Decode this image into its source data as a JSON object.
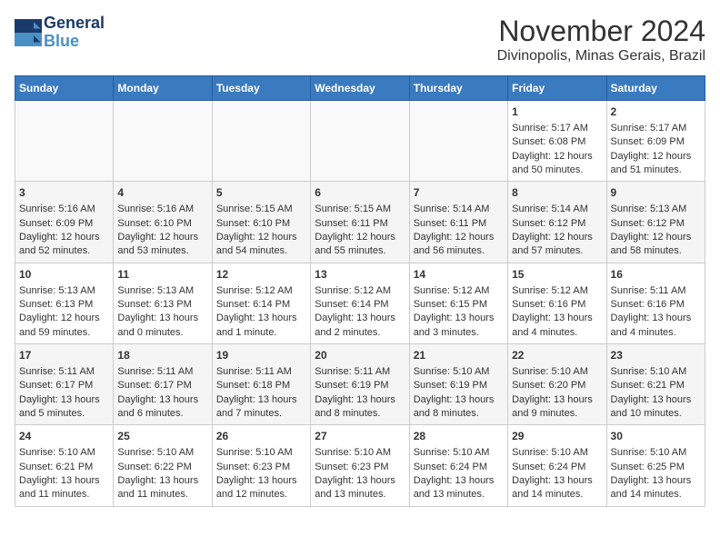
{
  "header": {
    "logo_line1": "General",
    "logo_line2": "Blue",
    "month": "November 2024",
    "location": "Divinopolis, Minas Gerais, Brazil"
  },
  "days_of_week": [
    "Sunday",
    "Monday",
    "Tuesday",
    "Wednesday",
    "Thursday",
    "Friday",
    "Saturday"
  ],
  "weeks": [
    [
      {
        "day": "",
        "info": ""
      },
      {
        "day": "",
        "info": ""
      },
      {
        "day": "",
        "info": ""
      },
      {
        "day": "",
        "info": ""
      },
      {
        "day": "",
        "info": ""
      },
      {
        "day": "1",
        "info": "Sunrise: 5:17 AM\nSunset: 6:08 PM\nDaylight: 12 hours and 50 minutes."
      },
      {
        "day": "2",
        "info": "Sunrise: 5:17 AM\nSunset: 6:09 PM\nDaylight: 12 hours and 51 minutes."
      }
    ],
    [
      {
        "day": "3",
        "info": "Sunrise: 5:16 AM\nSunset: 6:09 PM\nDaylight: 12 hours and 52 minutes."
      },
      {
        "day": "4",
        "info": "Sunrise: 5:16 AM\nSunset: 6:10 PM\nDaylight: 12 hours and 53 minutes."
      },
      {
        "day": "5",
        "info": "Sunrise: 5:15 AM\nSunset: 6:10 PM\nDaylight: 12 hours and 54 minutes."
      },
      {
        "day": "6",
        "info": "Sunrise: 5:15 AM\nSunset: 6:11 PM\nDaylight: 12 hours and 55 minutes."
      },
      {
        "day": "7",
        "info": "Sunrise: 5:14 AM\nSunset: 6:11 PM\nDaylight: 12 hours and 56 minutes."
      },
      {
        "day": "8",
        "info": "Sunrise: 5:14 AM\nSunset: 6:12 PM\nDaylight: 12 hours and 57 minutes."
      },
      {
        "day": "9",
        "info": "Sunrise: 5:13 AM\nSunset: 6:12 PM\nDaylight: 12 hours and 58 minutes."
      }
    ],
    [
      {
        "day": "10",
        "info": "Sunrise: 5:13 AM\nSunset: 6:13 PM\nDaylight: 12 hours and 59 minutes."
      },
      {
        "day": "11",
        "info": "Sunrise: 5:13 AM\nSunset: 6:13 PM\nDaylight: 13 hours and 0 minutes."
      },
      {
        "day": "12",
        "info": "Sunrise: 5:12 AM\nSunset: 6:14 PM\nDaylight: 13 hours and 1 minute."
      },
      {
        "day": "13",
        "info": "Sunrise: 5:12 AM\nSunset: 6:14 PM\nDaylight: 13 hours and 2 minutes."
      },
      {
        "day": "14",
        "info": "Sunrise: 5:12 AM\nSunset: 6:15 PM\nDaylight: 13 hours and 3 minutes."
      },
      {
        "day": "15",
        "info": "Sunrise: 5:12 AM\nSunset: 6:16 PM\nDaylight: 13 hours and 4 minutes."
      },
      {
        "day": "16",
        "info": "Sunrise: 5:11 AM\nSunset: 6:16 PM\nDaylight: 13 hours and 4 minutes."
      }
    ],
    [
      {
        "day": "17",
        "info": "Sunrise: 5:11 AM\nSunset: 6:17 PM\nDaylight: 13 hours and 5 minutes."
      },
      {
        "day": "18",
        "info": "Sunrise: 5:11 AM\nSunset: 6:17 PM\nDaylight: 13 hours and 6 minutes."
      },
      {
        "day": "19",
        "info": "Sunrise: 5:11 AM\nSunset: 6:18 PM\nDaylight: 13 hours and 7 minutes."
      },
      {
        "day": "20",
        "info": "Sunrise: 5:11 AM\nSunset: 6:19 PM\nDaylight: 13 hours and 8 minutes."
      },
      {
        "day": "21",
        "info": "Sunrise: 5:10 AM\nSunset: 6:19 PM\nDaylight: 13 hours and 8 minutes."
      },
      {
        "day": "22",
        "info": "Sunrise: 5:10 AM\nSunset: 6:20 PM\nDaylight: 13 hours and 9 minutes."
      },
      {
        "day": "23",
        "info": "Sunrise: 5:10 AM\nSunset: 6:21 PM\nDaylight: 13 hours and 10 minutes."
      }
    ],
    [
      {
        "day": "24",
        "info": "Sunrise: 5:10 AM\nSunset: 6:21 PM\nDaylight: 13 hours and 11 minutes."
      },
      {
        "day": "25",
        "info": "Sunrise: 5:10 AM\nSunset: 6:22 PM\nDaylight: 13 hours and 11 minutes."
      },
      {
        "day": "26",
        "info": "Sunrise: 5:10 AM\nSunset: 6:23 PM\nDaylight: 13 hours and 12 minutes."
      },
      {
        "day": "27",
        "info": "Sunrise: 5:10 AM\nSunset: 6:23 PM\nDaylight: 13 hours and 13 minutes."
      },
      {
        "day": "28",
        "info": "Sunrise: 5:10 AM\nSunset: 6:24 PM\nDaylight: 13 hours and 13 minutes."
      },
      {
        "day": "29",
        "info": "Sunrise: 5:10 AM\nSunset: 6:24 PM\nDaylight: 13 hours and 14 minutes."
      },
      {
        "day": "30",
        "info": "Sunrise: 5:10 AM\nSunset: 6:25 PM\nDaylight: 13 hours and 14 minutes."
      }
    ]
  ]
}
